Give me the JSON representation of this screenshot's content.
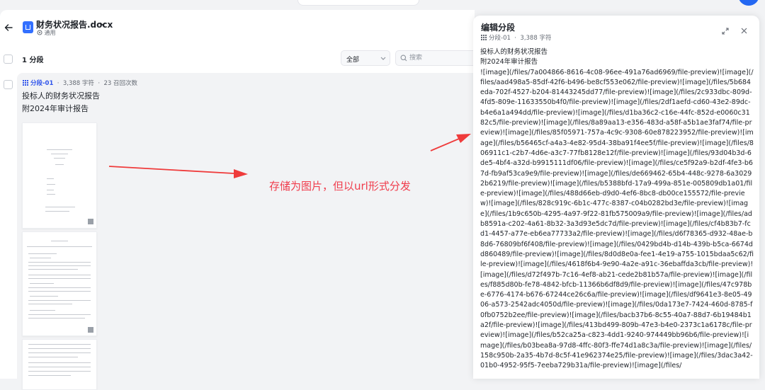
{
  "document": {
    "title": "财务状况报告.docx",
    "type_label": "通用"
  },
  "toolbar": {
    "segment_count": "1 分段",
    "filter_value": "全部",
    "search_placeholder": "搜索"
  },
  "segment": {
    "id": "分段-01",
    "chars": "3,388 字符",
    "recalls": "23 召回次数",
    "line1": "投标人的财务状况报告",
    "line2": "附2024年审计报告"
  },
  "annotation": "存储为图片，但以url形式分发",
  "panel": {
    "title": "编辑分段",
    "segment_id": "分段-01",
    "chars": "3,388 字符",
    "line1": "投标人的财务状况报告",
    "line2": "附2024年审计报告",
    "body": "![image](/files/7a004866-8616-4c08-96ee-491a76ad6969/file-preview)![image](/files/aad498a5-85df-42f6-b496-be8cf553e062/file-preview)![image](/files/5b684eda-702f-4527-b204-81443245dd77/file-preview)![image](/files/2c933dbc-809d-4fd5-809e-11633550b4f0/file-preview)![image](/files/2df1aefd-cd60-43e2-89dc-b4e6a1a494dd/file-preview)![image](/files/d1ba36c2-c16e-44fc-852d-e0060c3182c5/file-preview)![image](/files/8a89aa13-e356-483d-a58f-a5b1ae3faf74/file-preview)![image](/files/85f05971-757a-4c9c-9308-60e878223952/file-preview)![image](/files/b56465cf-a4a3-4e82-95d4-38ba91f4ee5f/file-preview)![image](/files/806911c1-c2b7-4d6e-a3c7-77fb8128e12f/file-preview)![image](/files/93d04b3d-6de5-4bf4-a32d-b9915111df06/file-preview)![image](/files/ce5f92a9-b2df-4fe3-b67d-fb9af53ca9e9/file-preview)![image](/files/de669462-65b4-448c-9278-6a30292b6219/file-preview)![image](/files/b5388bfd-17a9-499a-851e-005809db1a01/file-preview)![image](/files/488d66eb-d9d0-4ef6-8bc8-db00ce155572/file-preview)![image](/files/828c919c-6b1c-477c-8387-c04b0282bd3e/file-preview)![image](/files/1b9c650b-4295-4a97-9f22-81fb575009a9/file-preview)![image](/files/adb8591a-c202-4a61-8b32-3a3d93e5dc7d/file-preview)![image](/files/cf4b83b7-fcd1-4457-a77e-eb6ea77733a2/file-preview)![image](/files/d6f78365-d932-48ae-b8d6-76809bf6f408/file-preview)![image](/files/0429bd4b-d14b-439b-b5ca-6674dd860489/file-preview)![image](/files/8d0d8e0a-fee1-4e19-a755-1015bdaa5c62/file-preview)![image](/files/4618f6b4-9e90-4a2e-a91c-36ebaffda3cb/file-preview)![image](/files/d72f497b-7c16-4ef8-ab21-cede2b81b57a/file-preview)![image](/files/f885d80b-fe78-4842-bfcb-11366b6df8d9/file-preview)![image](/files/47c978be-6776-4174-b676-67244ce26c6a/file-preview)![image](/files/df9641e3-8e05-4906-a573-2542adc4050d/file-preview)![image](/files/0da173e7-7424-460d-8785-f0fb0752b2ee/file-preview)![image](/files/bacb37b6-8c55-40a7-88d7-6b19484b1a2f/file-preview)![image](/files/413bd499-809b-47e3-b4e0-2373c1a6178c/file-preview)![image](/files/b52ca25a-c823-4dd1-9240-974449bb96b6/file-preview)![image](/files/b03bea8a-97d8-4ffc-80f3-ffe74d1a8c3a/file-preview)![image](/files/158c950b-2a35-4b7d-8c5f-41e962374e25/file-preview)![image](/files/3dac3a42-01b0-4952-95f5-7eeba729b31a/file-preview)![image](/files/"
  },
  "colors": {
    "accent": "#2f54eb",
    "brand_blue": "#3370ff",
    "annotation_red": "#f03c4c"
  },
  "icons": [
    "back-arrow-icon",
    "document-icon",
    "chevron-down-icon",
    "grid-icon",
    "search-icon",
    "expand-icon",
    "close-icon"
  ]
}
